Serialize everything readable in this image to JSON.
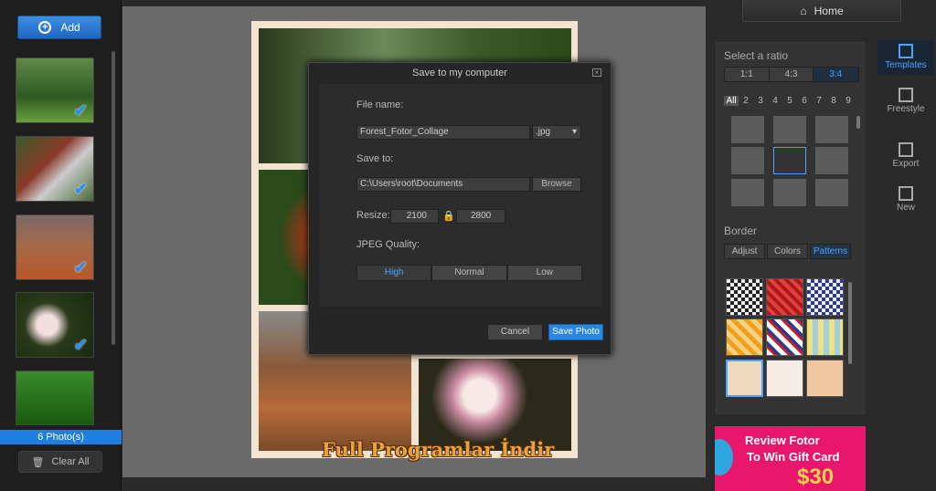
{
  "left": {
    "add_label": "Add",
    "photo_count": "6 Photo(s)",
    "clear_label": "Clear All"
  },
  "right": {
    "home_label": "Home",
    "ratio_title": "Select a ratio",
    "ratios": [
      "1:1",
      "4:3",
      "3:4"
    ],
    "counts": [
      "All",
      "2",
      "3",
      "4",
      "5",
      "6",
      "7",
      "8",
      "9"
    ],
    "border_title": "Border",
    "border_tabs": [
      "Adjust",
      "Colors",
      "Patterns"
    ],
    "tools": [
      "Templates",
      "Freestyle",
      "Export",
      "New"
    ]
  },
  "dialog": {
    "title": "Save to my computer",
    "file_name_label": "File name:",
    "file_name": "Forest_Fotor_Collage",
    "format": ".jpg",
    "save_to_label": "Save to:",
    "path": "C:\\Users\\root\\Documents",
    "browse": "Browse",
    "resize_label": "Resize:",
    "width": "2100",
    "height": "2800",
    "quality_label": "JPEG Quality:",
    "quality": [
      "High",
      "Normal",
      "Low"
    ],
    "cancel": "Cancel",
    "save": "Save Photo"
  },
  "ad": {
    "line1": "Review Fotor",
    "line2": "To Win Gift Card",
    "line3": "$30"
  },
  "watermark": "Full Programlar İndir",
  "colors": {
    "accent": "#2a87e0",
    "selected": "#4aa3ff"
  }
}
